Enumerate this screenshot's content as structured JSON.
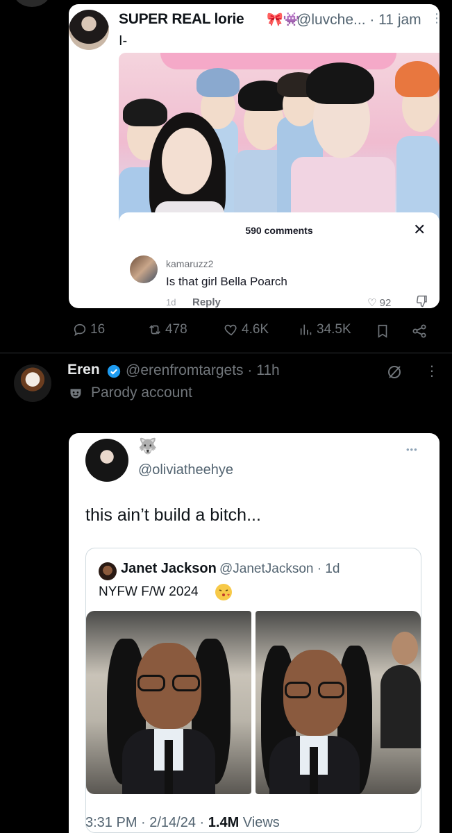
{
  "tweet1": {
    "author_name": "SUPER REAL lorie",
    "author_emoji": "🎀👾",
    "handle_time": "@luvche... · 11 jam",
    "body": "I-",
    "tiktok_comments": {
      "count_label": "590 comments",
      "close": "✕",
      "commenter": "kamaruzz2",
      "comment_text": "Is that girl Bella Poarch",
      "time": "1d",
      "reply_label": "Reply",
      "likes": "92"
    },
    "actions": {
      "replies": "16",
      "reposts": "478",
      "likes": "4.6K",
      "views": "34.5K"
    }
  },
  "tweet2": {
    "author_name": "Eren",
    "handle_time": "@erenfromtargets · 11h",
    "parody_label": "Parody account",
    "embedded": {
      "emoji": "🐺",
      "handle": "@oliviatheehye",
      "text": "this ain’t build a bitch...",
      "quote": {
        "name": "Janet Jackson",
        "handle_time": "@JanetJackson · 1d",
        "text": "NYFW F/W 2024"
      },
      "time": "3:31 PM · 2/14/24 · ",
      "views": "1.4M",
      "views_label": " Views"
    }
  },
  "colors": {
    "background": "#000000",
    "muted": "#71767b",
    "verified": "#1d9bf0"
  }
}
